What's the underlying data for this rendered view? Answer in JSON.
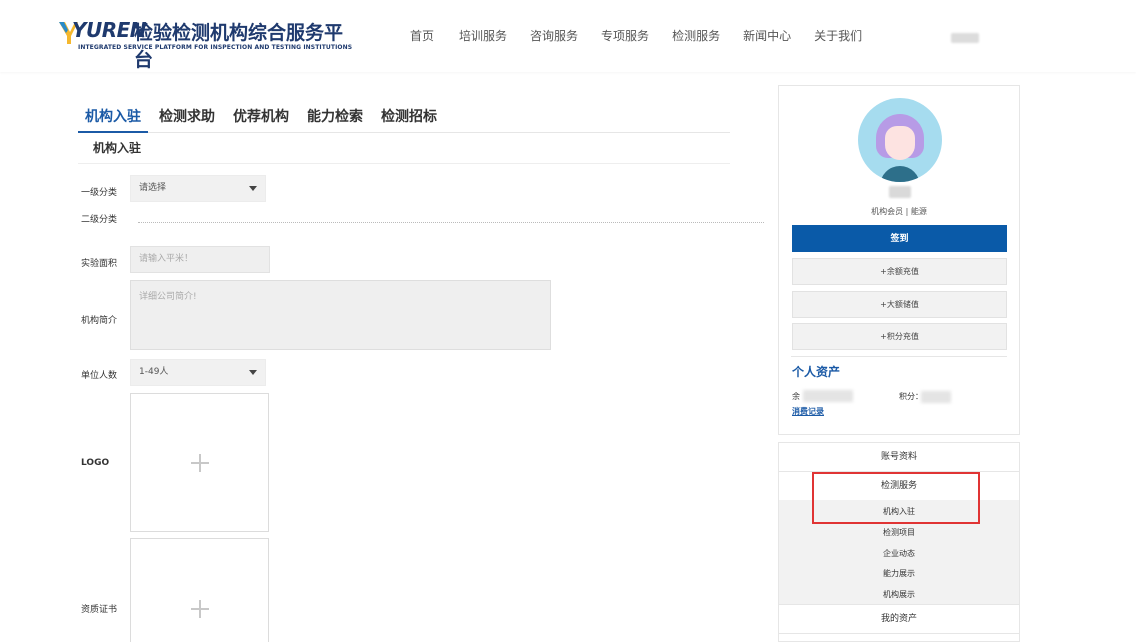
{
  "header": {
    "logo_word": "YUREN",
    "logo_title": "检验检测机构综合服务平台",
    "logo_subtitle": "INTEGRATED SERVICE PLATFORM FOR INSPECTION AND TESTING INSTITUTIONS",
    "nav": [
      "首页",
      "培训服务",
      "咨询服务",
      "专项服务",
      "检测服务",
      "新闻中心",
      "关于我们"
    ]
  },
  "main": {
    "tabs": [
      "机构入驻",
      "检测求助",
      "优荐机构",
      "能力检索",
      "检测招标"
    ],
    "active_tab": "机构入驻",
    "section_title": "机构入驻",
    "form": {
      "category1_label": "一级分类",
      "category1_value": "请选择",
      "category2_label": "二级分类",
      "lab_area_label": "实验面积",
      "lab_area_placeholder": "请输入平米！",
      "intro_label": "机构简介",
      "intro_placeholder": "详细公司简介!",
      "staff_label": "单位人数",
      "staff_value": "1-49人",
      "logo_label": "LOGO",
      "cert_label": "资质证书"
    }
  },
  "sidebar": {
    "member_text": "机构会员 | 能源",
    "signin_label": "签到",
    "buttons": [
      "+余额充值",
      "+大额储值",
      "+积分充值"
    ],
    "assets_title": "个人资产",
    "balance_label": "余",
    "points_label": "积分：",
    "consume_link": "消费记录",
    "menu": {
      "account": "账号资料",
      "testing_service": "检测服务",
      "sub_items": [
        "机构入驻",
        "检测项目",
        "企业动态",
        "能力展示",
        "机构展示"
      ],
      "my_assets": "我的资产"
    }
  },
  "colors": {
    "brand_blue": "#0a5aa8",
    "accent_red": "#e03434",
    "logo_yellow": "#f5b82e"
  }
}
